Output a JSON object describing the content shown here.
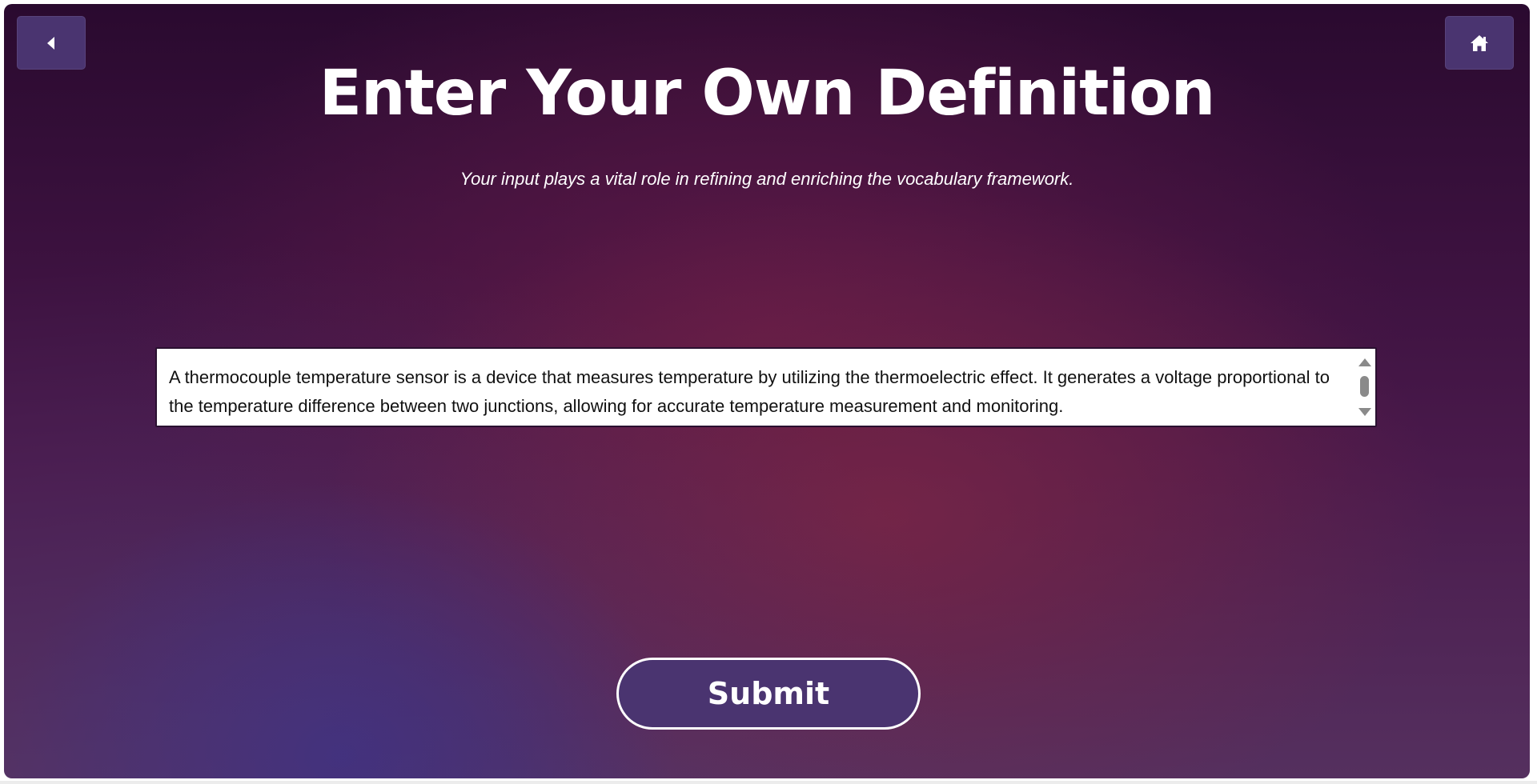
{
  "page": {
    "title": "Enter Your Own Definition",
    "subtitle": "Your input plays a vital role in refining and enriching the vocabulary framework."
  },
  "nav": {
    "back_icon": "caret-left-icon",
    "home_icon": "home-icon"
  },
  "definition": {
    "value": "A thermocouple temperature sensor is a device that measures temperature by utilizing the thermoelectric effect. It generates a voltage proportional to the temperature difference between two junctions, allowing for accurate temperature measurement and monitoring."
  },
  "actions": {
    "submit_label": "Submit"
  },
  "colors": {
    "button_bg": "#4a3470",
    "text": "#ffffff"
  }
}
